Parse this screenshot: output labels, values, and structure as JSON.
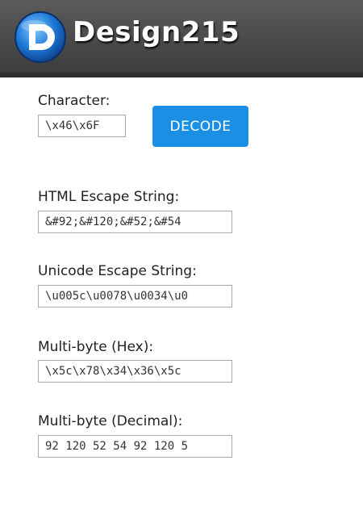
{
  "header": {
    "logo_text": "Design215"
  },
  "form": {
    "character_label": "Character:",
    "character_value": "\\x46\\x6F",
    "decode_label": "DECODE",
    "html_label": "HTML Escape String:",
    "html_value": "&#92;&#120;&#52;&#54",
    "unicode_label": "Unicode Escape String:",
    "unicode_value": "\\u005c\\u0078\\u0034\\u0",
    "hex_label": "Multi-byte (Hex):",
    "hex_value": "\\x5c\\x78\\x34\\x36\\x5c",
    "decimal_label": "Multi-byte (Decimal):",
    "decimal_value": "92 120 52 54 92 120 5"
  },
  "colors": {
    "header": "#4a4a4a",
    "button": "#1a8fe3",
    "logo_blue": "#1565c0"
  }
}
